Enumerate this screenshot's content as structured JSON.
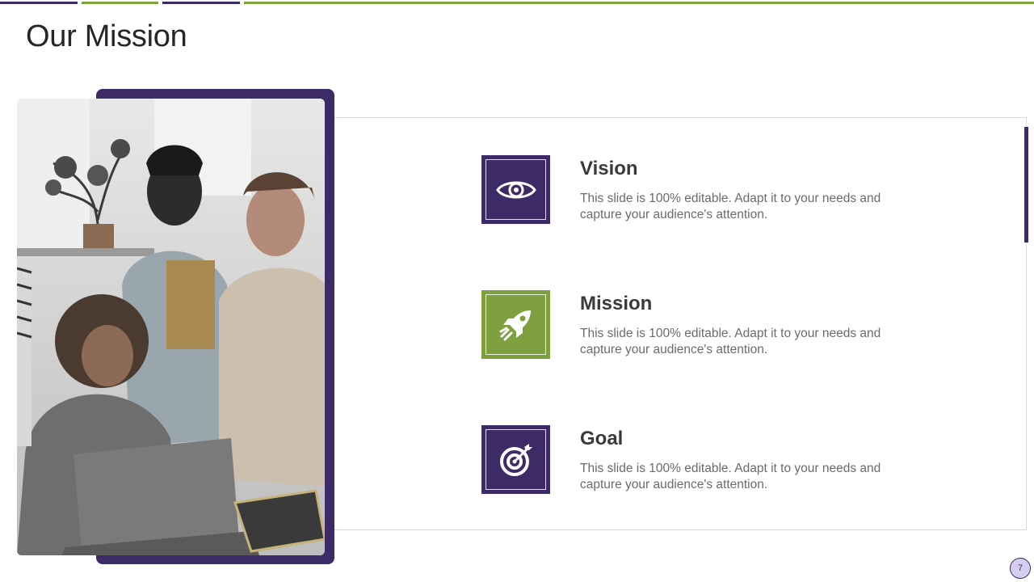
{
  "slide": {
    "title": "Our Mission",
    "page_number": "7"
  },
  "items": [
    {
      "title": "Vision",
      "text": "This slide is 100% editable. Adapt it to your needs and capture your audience's attention.",
      "icon": "eye-icon",
      "color": "#3d2b67"
    },
    {
      "title": "Mission",
      "text": "This slide is 100% editable. Adapt it to your needs and capture your audience's attention.",
      "icon": "rocket-icon",
      "color": "#7ea03e"
    },
    {
      "title": "Goal",
      "text": "This slide is 100% editable. Adapt it to your needs and capture your audience's attention.",
      "icon": "target-icon",
      "color": "#3d2b67"
    }
  ],
  "colors": {
    "primary": "#3d2b67",
    "accent": "#7ea03e"
  }
}
